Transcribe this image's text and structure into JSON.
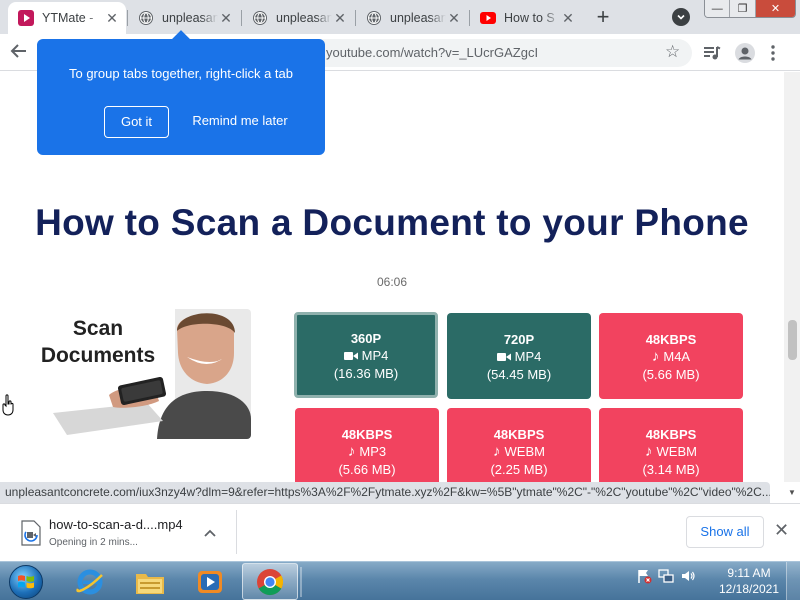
{
  "browser": {
    "tabs": [
      {
        "title": "YTMate - ",
        "icon": "ytmate-icon",
        "active": true
      },
      {
        "title": "unpleasant",
        "icon": "globe-icon",
        "active": false
      },
      {
        "title": "unpleasant",
        "icon": "globe-icon",
        "active": false
      },
      {
        "title": "unpleasant",
        "icon": "globe-icon",
        "active": false
      },
      {
        "title": "How to S",
        "icon": "youtube-icon",
        "active": false
      }
    ],
    "url": "youtube.com/watch?v=_LUcrGAZgcI",
    "window_buttons": {
      "minimize": "—",
      "restore": "❐",
      "close": "✕"
    }
  },
  "promo": {
    "text": "To group tabs together, right-click a tab",
    "got_it": "Got it",
    "remind": "Remind me later"
  },
  "page": {
    "title": "How to Scan a Document to your Phone",
    "duration": "06:06",
    "thumbnail_text_line1": "Scan",
    "thumbnail_text_line2": "Documents",
    "downloads": [
      {
        "quality": "360P",
        "format": "MP4",
        "size": "(16.36 MB)",
        "kind": "video",
        "color": "#2b6b66",
        "selected": true
      },
      {
        "quality": "720P",
        "format": "MP4",
        "size": "(54.45 MB)",
        "kind": "video",
        "color": "#2b6b66",
        "selected": false
      },
      {
        "quality": "48KBPS",
        "format": "M4A",
        "size": "(5.66 MB)",
        "kind": "audio",
        "color": "#f2435f",
        "selected": false
      },
      {
        "quality": "48KBPS",
        "format": "MP3",
        "size": "(5.66 MB)",
        "kind": "audio",
        "color": "#f2435f",
        "selected": false
      },
      {
        "quality": "48KBPS",
        "format": "WEBM",
        "size": "(2.25 MB)",
        "kind": "audio",
        "color": "#f2435f",
        "selected": false
      },
      {
        "quality": "48KBPS",
        "format": "WEBM",
        "size": "(3.14 MB)",
        "kind": "audio",
        "color": "#f2435f",
        "selected": false
      }
    ]
  },
  "status_url": "unpleasantconcrete.com/iux3nzy4w?dlm=9&refer=https%3A%2F%2Fytmate.xyz%2F&kw=%5B\"ytmate\"%2C\"-\"%2C\"youtube\"%2C\"video\"%2C...",
  "download_shelf": {
    "filename": "how-to-scan-a-d....mp4",
    "status": "Opening in 2 mins...",
    "show_all": "Show all"
  },
  "taskbar": {
    "apps": [
      "internet-explorer-icon",
      "file-explorer-icon",
      "media-player-icon",
      "chrome-icon"
    ],
    "time": "9:11 AM",
    "date": "12/18/2021"
  }
}
